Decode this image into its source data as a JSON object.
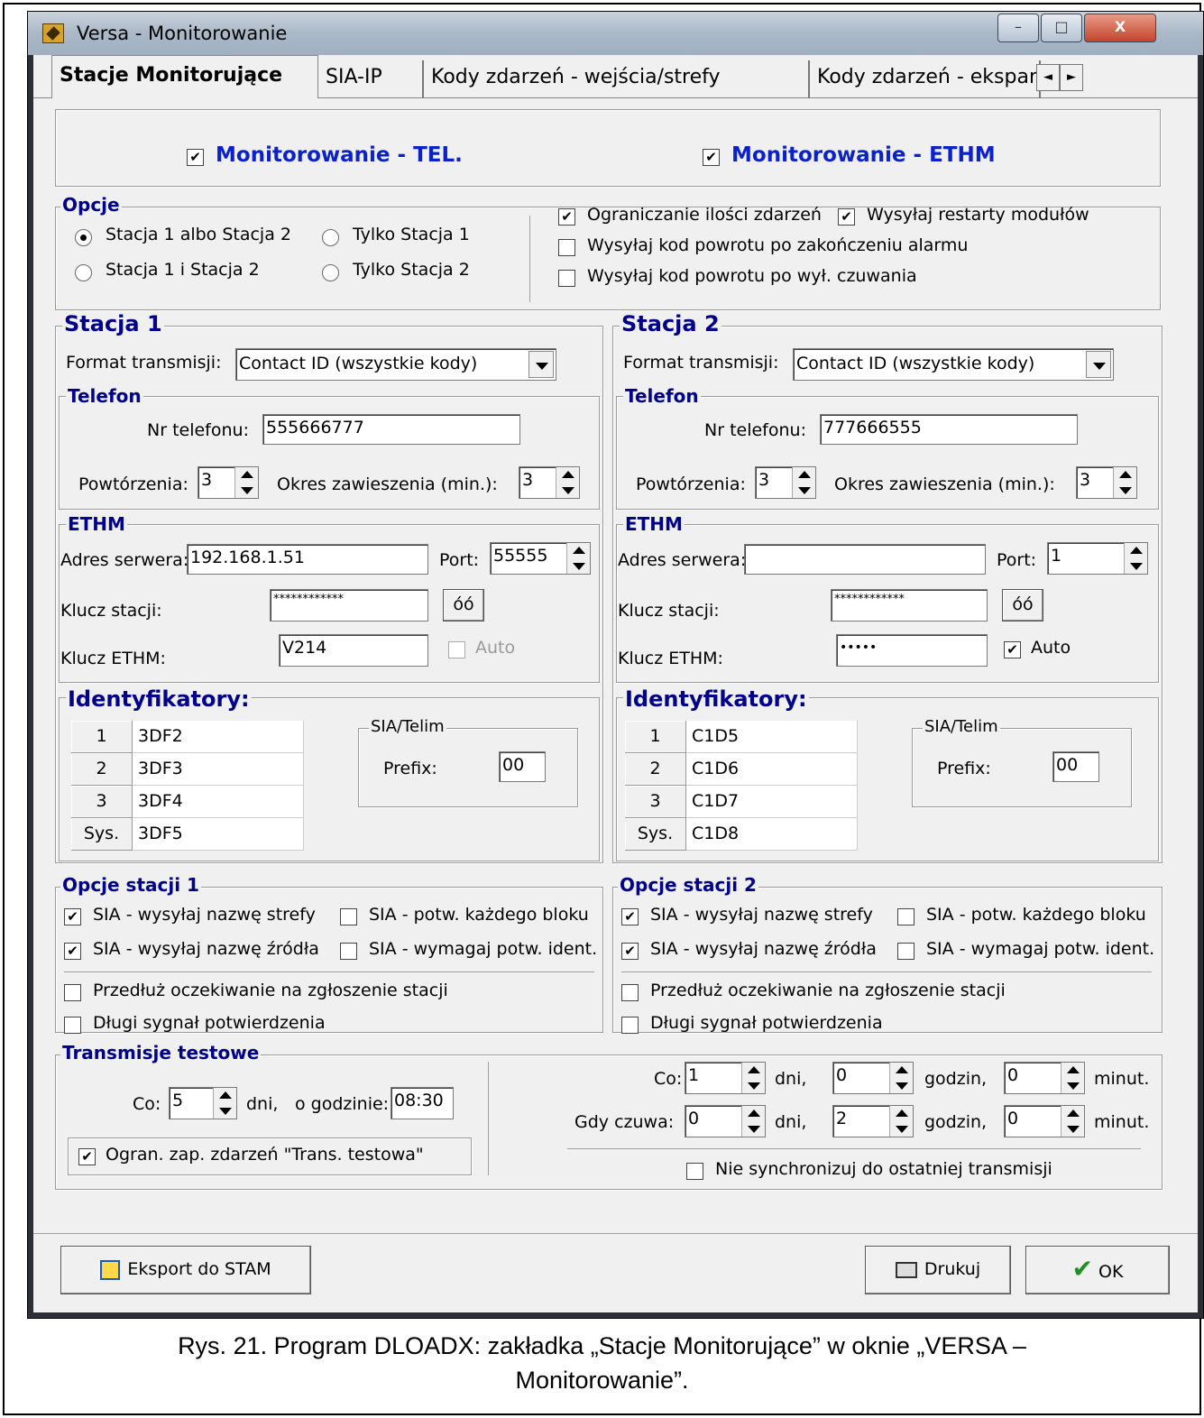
{
  "window": {
    "title": "Versa - Monitorowanie",
    "min": "–",
    "max": "□",
    "close": "X"
  },
  "tabs": [
    "Stacje Monitorujące",
    "SIA-IP",
    "Kody zdarzeń - wejścia/strefy",
    "Kody zdarzeń - ekspan"
  ],
  "tab_scroll": {
    "left": "◄",
    "right": "►"
  },
  "monitoring": {
    "tel": "Monitorowanie - TEL.",
    "ethm": "Monitorowanie - ETHM",
    "tel_checked": true,
    "ethm_checked": true
  },
  "options": {
    "title": "Opcje",
    "radio1": "Stacja 1 albo Stacja 2",
    "radio2": "Tylko Stacja 1",
    "radio3": "Stacja 1 i Stacja 2",
    "radio4": "Tylko Stacja 2",
    "cb1": "Ograniczanie ilości zdarzeń",
    "cb2": "Wysyłaj restarty modułów",
    "cb3": "Wysyłaj kod powrotu po zakończeniu alarmu",
    "cb4": "Wysyłaj kod powrotu po wył. czuwania"
  },
  "check": "✔",
  "station1": {
    "title": "Stacja 1",
    "format_label": "Format transmisji:",
    "format": "Contact ID (wszystkie kody)",
    "phone_title": "Telefon",
    "phone_label": "Nr telefonu:",
    "phone": "555666777",
    "repeats_label": "Powtórzenia:",
    "repeats": "3",
    "suspend_label": "Okres zawieszenia (min.):",
    "suspend": "3",
    "ethm_title": "ETHM",
    "server_label": "Adres serwera:",
    "server": "192.168.1.51",
    "port_label": "Port:",
    "port": "55555",
    "key_label": "Klucz stacji:",
    "key": "************",
    "ethm_key_label": "Klucz ETHM:",
    "ethm_key": "V214",
    "auto": "Auto",
    "eye": "óó",
    "ids_title": "Identyfikatory:",
    "ids": [
      {
        "n": "1",
        "v": "3DF2"
      },
      {
        "n": "2",
        "v": "3DF3"
      },
      {
        "n": "3",
        "v": "3DF4"
      },
      {
        "n": "Sys.",
        "v": "3DF5"
      }
    ],
    "sia_title": "SIA/Telim",
    "prefix_label": "Prefix:",
    "prefix": "00"
  },
  "station2": {
    "title": "Stacja 2",
    "format_label": "Format transmisji:",
    "format": "Contact ID (wszystkie kody)",
    "phone_title": "Telefon",
    "phone_label": "Nr telefonu:",
    "phone": "777666555",
    "repeats_label": "Powtórzenia:",
    "repeats": "3",
    "suspend_label": "Okres zawieszenia (min.):",
    "suspend": "3",
    "ethm_title": "ETHM",
    "server_label": "Adres serwera:",
    "server": "",
    "port_label": "Port:",
    "port": "1",
    "key_label": "Klucz stacji:",
    "key": "************",
    "ethm_key_label": "Klucz ETHM:",
    "ethm_key": "•••••",
    "auto": "Auto",
    "eye": "óó",
    "ids_title": "Identyfikatory:",
    "ids": [
      {
        "n": "1",
        "v": "C1D5"
      },
      {
        "n": "2",
        "v": "C1D6"
      },
      {
        "n": "3",
        "v": "C1D7"
      },
      {
        "n": "Sys.",
        "v": "C1D8"
      }
    ],
    "sia_title": "SIA/Telim",
    "prefix_label": "Prefix:",
    "prefix": "00"
  },
  "opts1": {
    "title": "Opcje stacji 1",
    "a": "SIA - wysyłaj nazwę strefy",
    "b": "SIA - potw. każdego bloku",
    "c": "SIA - wysyłaj nazwę źródła",
    "d": "SIA - wymagaj potw. ident.",
    "e": "Przedłuż oczekiwanie na zgłoszenie stacji",
    "f": "Długi sygnał potwierdzenia"
  },
  "opts2": {
    "title": "Opcje stacji 2",
    "a": "SIA - wysyłaj nazwę strefy",
    "b": "SIA - potw. każdego bloku",
    "c": "SIA - wysyłaj nazwę źródła",
    "d": "SIA - wymagaj potw. ident.",
    "e": "Przedłuż oczekiwanie na zgłoszenie stacji",
    "f": "Długi sygnał potwierdzenia"
  },
  "test": {
    "title": "Transmisje testowe",
    "co_label": "Co:",
    "co": "5",
    "dni": "dni,",
    "hour_label": "o godzinie:",
    "hour": "08:30",
    "limit": "Ogran. zap. zdarzeń \"Trans. testowa\"",
    "r_co_label": "Co:",
    "r_co_days": "1",
    "r_co_hours": "0",
    "r_co_min": "0",
    "r_arm_label": "Gdy czuwa:",
    "r_arm_days": "0",
    "r_arm_hours": "2",
    "r_arm_min": "0",
    "dni2": "dni,",
    "godzin": "godzin,",
    "minut": "minut.",
    "nosync": "Nie synchronizuj do ostatniej transmisji"
  },
  "buttons": {
    "export": "Eksport do STAM",
    "print": "Drukuj",
    "ok": "OK"
  },
  "caption": {
    "line1": "Rys. 21. Program DLOADX: zakładka „Stacje Monitorujące” w oknie „VERSA –",
    "line2": "Monitorowanie”."
  }
}
